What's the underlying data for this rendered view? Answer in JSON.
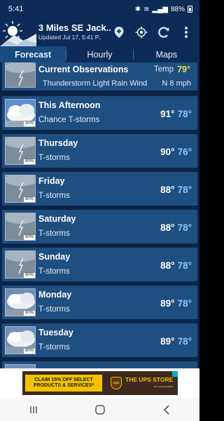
{
  "status": {
    "time": "5:41",
    "battery": "88%"
  },
  "header": {
    "location": "3 Miles SE Jack..",
    "updated": "Updated Jul 17, 5:41 P.."
  },
  "tabs": [
    {
      "label": "Forecast",
      "active": true
    },
    {
      "label": "Hourly",
      "active": false
    },
    {
      "label": "Maps",
      "active": false
    }
  ],
  "current": {
    "title": "Current Observations",
    "temp_label": "Temp",
    "temp_value": "79°",
    "description": "Thunderstorm Light Rain Wind",
    "wind": "N 8 mph",
    "icon": "thunderstorm-icon"
  },
  "forecast": [
    {
      "day": "This Afternoon",
      "condition": "Chance T-storms",
      "high": "91°",
      "low": "78°",
      "pop": "30%",
      "icon": "chance-tstorms-icon"
    },
    {
      "day": "Thursday",
      "condition": "T-storms",
      "high": "90°",
      "low": "76°",
      "pop": "80%",
      "icon": "thunderstorm-icon"
    },
    {
      "day": "Friday",
      "condition": "T-storms",
      "high": "88°",
      "low": "78°",
      "pop": "90%",
      "icon": "thunderstorm-icon"
    },
    {
      "day": "Saturday",
      "condition": "T-storms",
      "high": "88°",
      "low": "78°",
      "pop": "90%",
      "icon": "thunderstorm-icon"
    },
    {
      "day": "Sunday",
      "condition": "T-storms",
      "high": "88°",
      "low": "78°",
      "pop": "90%",
      "icon": "thunderstorm-icon"
    },
    {
      "day": "Monday",
      "condition": "T-storms",
      "high": "89°",
      "low": "78°",
      "pop": "80%",
      "icon": "chance-tstorms-icon"
    },
    {
      "day": "Tuesday",
      "condition": "T-storms",
      "high": "89°",
      "low": "78°",
      "pop": "80%",
      "icon": "chance-tstorms-icon"
    }
  ],
  "ad": {
    "left_text": "CLAIM 15% OFF SELECT PRODUCTS & SERVICES*",
    "logo_text": "ups",
    "right_text": "THE UPS STORE",
    "tagline": "be unstoppable"
  },
  "colors": {
    "accent_temp": "#e8e050",
    "low_temp": "#8fc8f0",
    "header_bg": "#0c2c57",
    "row_bg": "#1f4e80"
  }
}
